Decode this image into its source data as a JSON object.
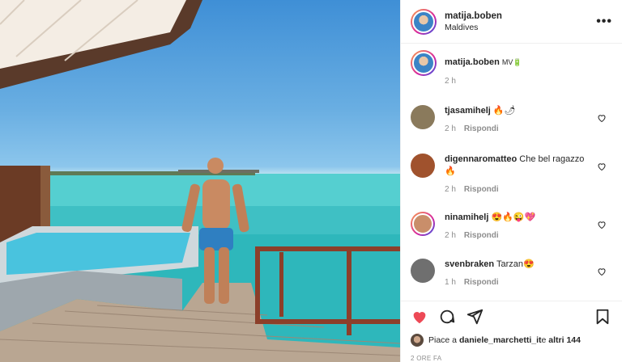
{
  "header": {
    "username": "matija.boben",
    "location": "Maldives",
    "more": "•••"
  },
  "caption": {
    "username": "matija.boben",
    "text": "MV🔋",
    "time": "2 h"
  },
  "comments": [
    {
      "username": "tjasamihelj",
      "text": "🔥🌶",
      "time": "2 h",
      "reply": "Rispondi",
      "avatar_color": "#8a7a5c"
    },
    {
      "username": "digennaromatteo",
      "text": "Che bel ragazzo 🔥",
      "time": "2 h",
      "reply": "Rispondi",
      "avatar_color": "#a0522d"
    },
    {
      "username": "ninamihelj",
      "text": "😍🔥😜💖",
      "time": "2 h",
      "reply": "Rispondi",
      "avatar_color": "#c98e6a"
    },
    {
      "username": "svenbraken",
      "text": "Tarzan😍",
      "time": "1 h",
      "reply": "Rispondi",
      "avatar_color": "#6f6f6f"
    }
  ],
  "likes": {
    "prefix": "Piace a ",
    "user": "daniele_marchetti_it",
    "middle": " e ",
    "others": "altri 144"
  },
  "posted": "2 ORE FA",
  "colors": {
    "like_red": "#ed4956",
    "muted": "#8e8e8e",
    "text": "#262626"
  },
  "icons": [
    "heart-icon",
    "comment-icon",
    "share-icon",
    "bookmark-icon",
    "more-icon"
  ]
}
